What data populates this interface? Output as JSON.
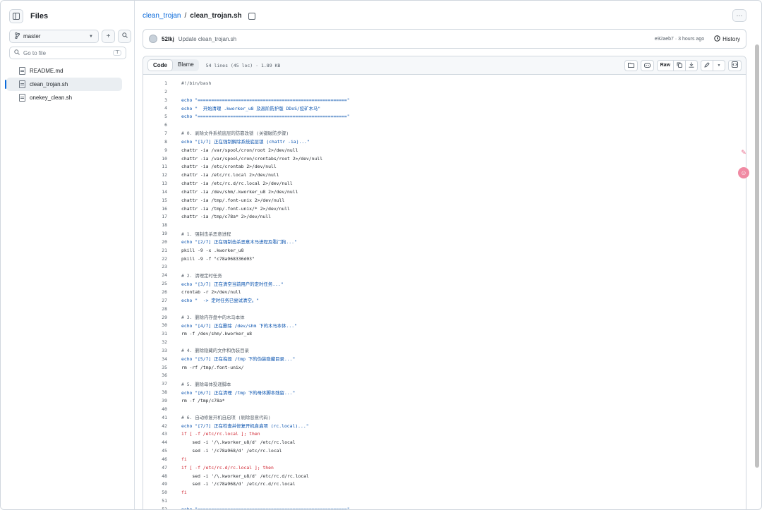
{
  "sidebar": {
    "title": "Files",
    "branch": "master",
    "goto_placeholder": "Go to file",
    "goto_kbd": "T",
    "files": [
      "README.md",
      "clean_trojan.sh",
      "onekey_clean.sh"
    ]
  },
  "breadcrumb": {
    "repo": "clean_trojan",
    "sep": "/",
    "file": "clean_trojan.sh"
  },
  "commit": {
    "author": "52lkj",
    "message": "Update clean_trojan.sh",
    "meta": "e92aeb7 · 3 hours ago",
    "history": "History"
  },
  "file_header": {
    "tab_code": "Code",
    "tab_blame": "Blame",
    "meta": "54 lines (45 loc) · 1.89 KB",
    "raw": "Raw"
  },
  "icons": {
    "sidebar_toggle": "sidebar-toggle-icon",
    "branch": "git-branch-icon",
    "plus": "plus-icon",
    "search": "search-icon",
    "file": "file-icon",
    "copy": "copy-icon",
    "kebab": "kebab-horizontal-icon",
    "history": "history-icon"
  },
  "code_lines": [
    {
      "n": "1",
      "t": "#!/bin/bash"
    },
    {
      "n": "2",
      "t": ""
    },
    {
      "n": "3",
      "t": "echo \"=======================================================\""
    },
    {
      "n": "4",
      "t": "echo \"  开始清理 .kworker_u8 及高阶防护版 DDoS/挖矿木马\""
    },
    {
      "n": "5",
      "t": "echo \"=======================================================\""
    },
    {
      "n": "6",
      "t": ""
    },
    {
      "n": "7",
      "t": "# 0. 剥除文件系统底层的防篡改锁 (关键破防步骤)"
    },
    {
      "n": "8",
      "t": "echo \"[1/7] 正在强制解除系统底层锁 (chattr -ia)...\""
    },
    {
      "n": "9",
      "t": "chattr -ia /var/spool/cron/root 2>/dev/null"
    },
    {
      "n": "10",
      "t": "chattr -ia /var/spool/cron/crontabs/root 2>/dev/null"
    },
    {
      "n": "11",
      "t": "chattr -ia /etc/crontab 2>/dev/null"
    },
    {
      "n": "12",
      "t": "chattr -ia /etc/rc.local 2>/dev/null"
    },
    {
      "n": "13",
      "t": "chattr -ia /etc/rc.d/rc.local 2>/dev/null"
    },
    {
      "n": "14",
      "t": "chattr -ia /dev/shm/.kworker_u8 2>/dev/null"
    },
    {
      "n": "15",
      "t": "chattr -ia /tmp/.font-unix 2>/dev/null"
    },
    {
      "n": "16",
      "t": "chattr -ia /tmp/.font-unix/* 2>/dev/null"
    },
    {
      "n": "17",
      "t": "chattr -ia /tmp/c78a* 2>/dev/null"
    },
    {
      "n": "18",
      "t": ""
    },
    {
      "n": "19",
      "t": "# 1. 强制击杀恶意进程"
    },
    {
      "n": "20",
      "t": "echo \"[2/7] 正在强制击杀恶意木马进程及看门狗...\""
    },
    {
      "n": "21",
      "t": "pkill -9 -x .kworker_u8"
    },
    {
      "n": "22",
      "t": "pkill -9 -f \"c78a968336d03\""
    },
    {
      "n": "23",
      "t": ""
    },
    {
      "n": "24",
      "t": "# 2. 清理定时任务"
    },
    {
      "n": "25",
      "t": "echo \"[3/7] 正在清空当前用户的定时任务...\""
    },
    {
      "n": "26",
      "t": "crontab -r 2>/dev/null"
    },
    {
      "n": "27",
      "t": "echo \"  -> 定时任务已尝试清空。\""
    },
    {
      "n": "28",
      "t": ""
    },
    {
      "n": "29",
      "t": "# 3. 删除内存盘中的木马本体"
    },
    {
      "n": "30",
      "t": "echo \"[4/7] 正在删除 /dev/shm 下的木马本体...\""
    },
    {
      "n": "31",
      "t": "rm -f /dev/shm/.kworker_u8"
    },
    {
      "n": "32",
      "t": ""
    },
    {
      "n": "33",
      "t": "# 4. 删除隐藏的文件和伪装目录"
    },
    {
      "n": "34",
      "t": "echo \"[5/7] 正在捣毁 /tmp 下的伪装隐藏目录...\""
    },
    {
      "n": "35",
      "t": "rm -rf /tmp/.font-unix/"
    },
    {
      "n": "36",
      "t": ""
    },
    {
      "n": "37",
      "t": "# 5. 删除母体投递脚本"
    },
    {
      "n": "38",
      "t": "echo \"[6/7] 正在清理 /tmp 下的母体脚本残留...\""
    },
    {
      "n": "39",
      "t": "rm -f /tmp/c78a*"
    },
    {
      "n": "40",
      "t": ""
    },
    {
      "n": "41",
      "t": "# 6. 自动修复开机自启项 (剔除恶意代码)"
    },
    {
      "n": "42",
      "t": "echo \"[7/7] 正在检查并修复开机自启项 (rc.local)...\""
    },
    {
      "n": "43",
      "t": "if [ -f /etc/rc.local ]; then"
    },
    {
      "n": "44",
      "t": "    sed -i '/\\.kworker_u8/d' /etc/rc.local"
    },
    {
      "n": "45",
      "t": "    sed -i '/c78a968/d' /etc/rc.local"
    },
    {
      "n": "46",
      "t": "fi"
    },
    {
      "n": "47",
      "t": "if [ -f /etc/rc.d/rc.local ]; then"
    },
    {
      "n": "48",
      "t": "    sed -i '/\\.kworker_u8/d' /etc/rc.d/rc.local"
    },
    {
      "n": "49",
      "t": "    sed -i '/c78a968/d' /etc/rc.d/rc.local"
    },
    {
      "n": "50",
      "t": "fi"
    },
    {
      "n": "51",
      "t": ""
    },
    {
      "n": "52",
      "t": "echo \"=======================================================\""
    }
  ],
  "colors": {
    "link": "#0969da",
    "keyword": "#cf222e",
    "string": "#0a3069",
    "comment": "#57606a"
  }
}
